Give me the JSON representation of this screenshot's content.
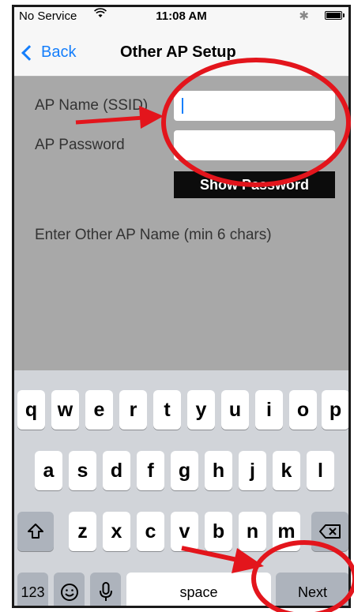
{
  "status_bar": {
    "carrier": "No Service",
    "time": "11:08 AM",
    "bluetooth_symbol": "✱"
  },
  "nav": {
    "back_label": "Back",
    "title": "Other AP Setup"
  },
  "form": {
    "ssid_label": "AP Name (SSID)",
    "ssid_value": "",
    "password_label": "AP Password",
    "password_value": "",
    "show_password_label": "Show Password",
    "hint": "Enter Other AP Name (min 6 chars)"
  },
  "keyboard": {
    "row1": [
      "q",
      "w",
      "e",
      "r",
      "t",
      "y",
      "u",
      "i",
      "o",
      "p"
    ],
    "row2": [
      "a",
      "s",
      "d",
      "f",
      "g",
      "h",
      "j",
      "k",
      "l"
    ],
    "row3": [
      "z",
      "x",
      "c",
      "v",
      "b",
      "n",
      "m"
    ],
    "numbers_label": "123",
    "space_label": "space",
    "next_label": "Next",
    "icons": {
      "shift": "shift-icon",
      "delete": "backspace-icon",
      "emoji": "emoji-icon",
      "mic": "microphone-icon"
    }
  },
  "annotations": {
    "color": "#e3151c"
  }
}
